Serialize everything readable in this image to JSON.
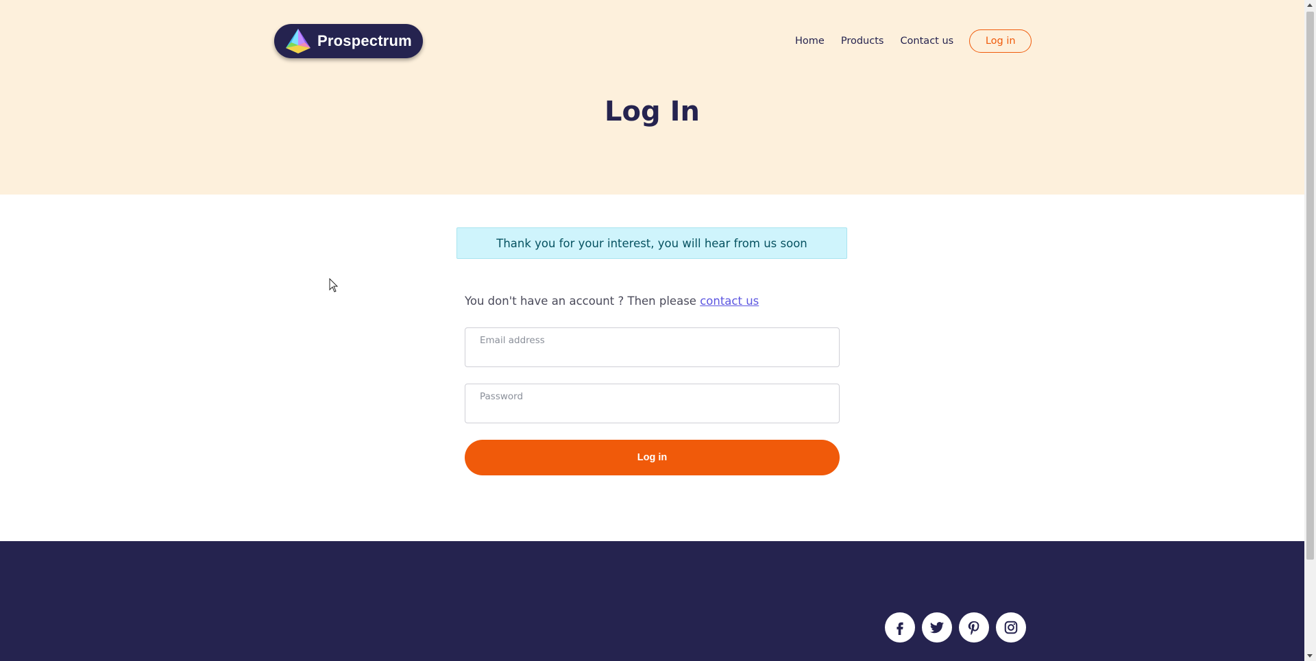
{
  "brand": {
    "name": "Prospectrum"
  },
  "nav": {
    "items": [
      {
        "label": "Home"
      },
      {
        "label": "Products"
      },
      {
        "label": "Contact us"
      }
    ],
    "login_label": "Log in"
  },
  "page": {
    "title": "Log In"
  },
  "alert": {
    "message": "Thank you for your interest, you will hear from us soon"
  },
  "signup": {
    "prefix": "You don't have an account ? Then please ",
    "link_label": "contact us"
  },
  "form": {
    "email_label": "Email address",
    "email_value": "",
    "password_label": "Password",
    "password_value": "",
    "submit_label": "Log in"
  },
  "footer": {
    "social_icons": [
      "facebook-icon",
      "twitter-icon",
      "pinterest-icon",
      "instagram-icon"
    ]
  },
  "colors": {
    "hero_background": "#fdf0dc",
    "brand_navy": "#25234f",
    "accent_orange": "#f05a0a",
    "alert_background": "#cff4fc",
    "link_blue": "#5b55e0"
  }
}
